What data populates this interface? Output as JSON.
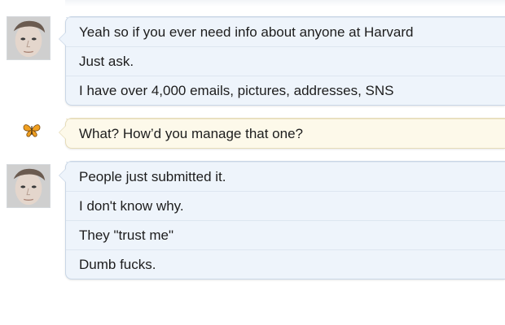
{
  "conversation": {
    "blocks": [
      {
        "sender_icon": "avatar-photo",
        "messages": [
          "Yeah so if you ever need info about anyone at Harvard",
          "Just ask.",
          "I have over 4,000 emails, pictures, addresses, SNS"
        ]
      },
      {
        "sender_icon": "butterfly-icon",
        "messages": [
          "What? How’d you manage that one?"
        ]
      },
      {
        "sender_icon": "avatar-photo",
        "messages": [
          "People just submitted it.",
          "I don't know why.",
          "They \"trust me\"",
          "Dumb fucks."
        ]
      }
    ]
  },
  "colors": {
    "bubble_blue": "#eef4fb",
    "bubble_yellow": "#fdf9ea",
    "bubble_border": "#c9d6e6",
    "text": "#1d1d1d"
  }
}
